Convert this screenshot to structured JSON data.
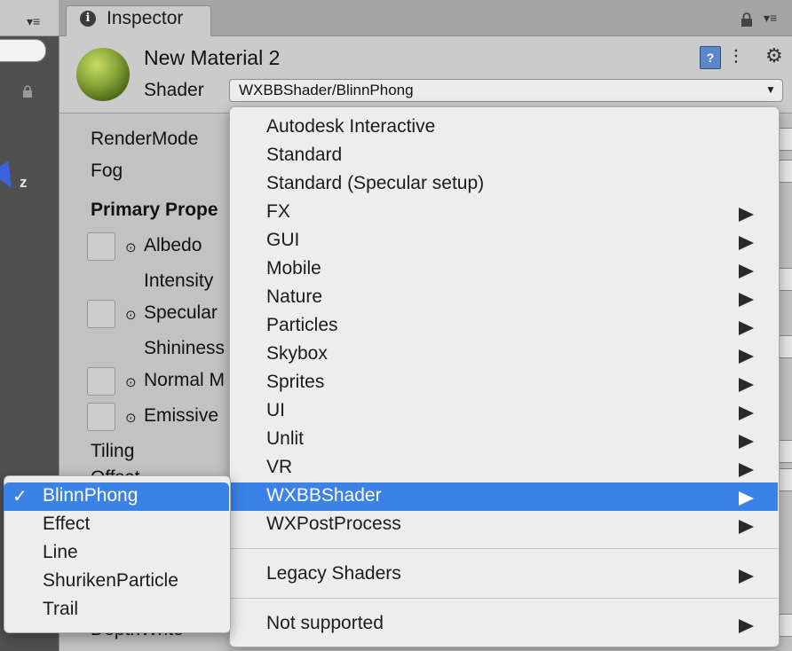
{
  "inspector": {
    "tab_title": "Inspector",
    "material_name": "New Material 2",
    "shader_label": "Shader",
    "shader_value": "WXBBShader/BlinnPhong"
  },
  "properties": {
    "render_mode": "RenderMode",
    "fog": "Fog",
    "primary_section": "Primary Prope",
    "albedo": "Albedo",
    "intensity": "Intensity",
    "specular": "Specular",
    "shininess": "Shininess",
    "normal_map": "Normal M",
    "emissive": "Emissive",
    "tiling": "Tiling",
    "offset": "Offset",
    "depth_write": "DepthWrite"
  },
  "scene": {
    "axis_label": "z"
  },
  "shader_menu": {
    "items": [
      {
        "label": "Autodesk Interactive",
        "submenu": false
      },
      {
        "label": "Standard",
        "submenu": false
      },
      {
        "label": "Standard (Specular setup)",
        "submenu": false
      },
      {
        "label": "FX",
        "submenu": true
      },
      {
        "label": "GUI",
        "submenu": true
      },
      {
        "label": "Mobile",
        "submenu": true
      },
      {
        "label": "Nature",
        "submenu": true
      },
      {
        "label": "Particles",
        "submenu": true
      },
      {
        "label": "Skybox",
        "submenu": true
      },
      {
        "label": "Sprites",
        "submenu": true
      },
      {
        "label": "UI",
        "submenu": true
      },
      {
        "label": "Unlit",
        "submenu": true
      },
      {
        "label": "VR",
        "submenu": true
      },
      {
        "label": "WXBBShader",
        "submenu": true,
        "selected": true
      },
      {
        "label": "WXPostProcess",
        "submenu": true
      },
      {
        "label": "Legacy Shaders",
        "submenu": true
      },
      {
        "label": "Not supported",
        "submenu": true
      }
    ]
  },
  "submenu": {
    "check_mark": "✓",
    "items": [
      {
        "label": "BlinnPhong",
        "checked": true
      },
      {
        "label": "Effect",
        "checked": false
      },
      {
        "label": "Line",
        "checked": false
      },
      {
        "label": "ShurikenParticle",
        "checked": false
      },
      {
        "label": "Trail",
        "checked": false
      }
    ]
  },
  "colors": {
    "selection": "#3b82e6",
    "panel": "#c2c2c2",
    "menu_bg": "#ededed"
  }
}
